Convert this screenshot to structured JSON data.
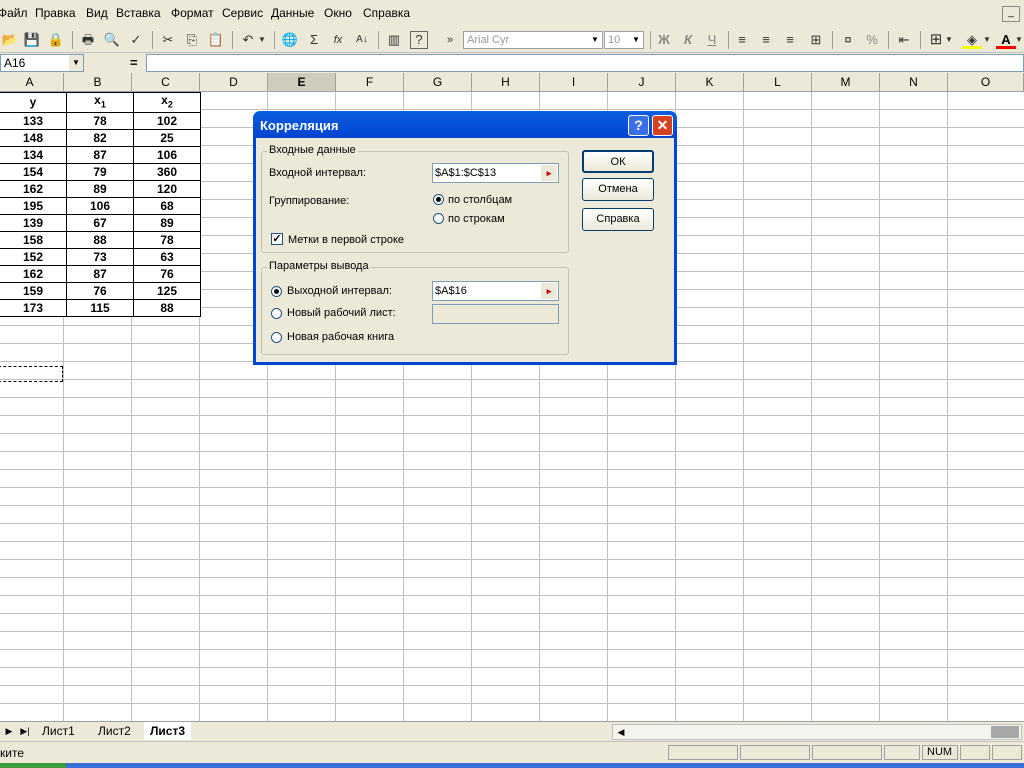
{
  "menu": [
    "Файл",
    "Правка",
    "Вид",
    "Вставка",
    "Формат",
    "Сервис",
    "Данные",
    "Окно",
    "Справка"
  ],
  "toolbar": {
    "font": "Arial Cyr",
    "size": "10",
    "bold": "Ж",
    "italic": "К",
    "underline": "Ч",
    "percent": "%",
    "sigma": "Σ",
    "fx": "fx"
  },
  "formula": {
    "namebox": "A16",
    "eq": "="
  },
  "columns": [
    "A",
    "B",
    "C",
    "D",
    "E",
    "F",
    "G",
    "H",
    "I",
    "J",
    "K",
    "L",
    "M",
    "N",
    "O"
  ],
  "table": {
    "headers": [
      "y",
      "x",
      "x"
    ],
    "header_subs": [
      "",
      "1",
      "2"
    ],
    "rows": [
      [
        "133",
        "78",
        "102"
      ],
      [
        "148",
        "82",
        "25"
      ],
      [
        "134",
        "87",
        "106"
      ],
      [
        "154",
        "79",
        "360"
      ],
      [
        "162",
        "89",
        "120"
      ],
      [
        "195",
        "106",
        "68"
      ],
      [
        "139",
        "67",
        "89"
      ],
      [
        "158",
        "88",
        "78"
      ],
      [
        "152",
        "73",
        "63"
      ],
      [
        "162",
        "87",
        "76"
      ],
      [
        "159",
        "76",
        "125"
      ],
      [
        "173",
        "115",
        "88"
      ]
    ]
  },
  "dialog": {
    "title": "Корреляция",
    "input_group": "Входные данные",
    "input_range_label": "Входной интервал:",
    "input_range_value": "$A$1:$C$13",
    "grouping_label": "Группирование:",
    "by_columns": "по столбцам",
    "by_rows": "по строкам",
    "labels_first_row": "Метки в первой строке",
    "output_group": "Параметры вывода",
    "output_range_label": "Выходной интервал:",
    "output_range_value": "$A$16",
    "new_sheet_label": "Новый рабочий лист:",
    "new_book_label": "Новая рабочая книга",
    "ok": "ОК",
    "cancel": "Отмена",
    "help": "Справка"
  },
  "sheets": [
    "Лист1",
    "Лист2",
    "Лист3"
  ],
  "active_sheet": "Лист3",
  "status": {
    "text": "ките",
    "num": "NUM"
  }
}
